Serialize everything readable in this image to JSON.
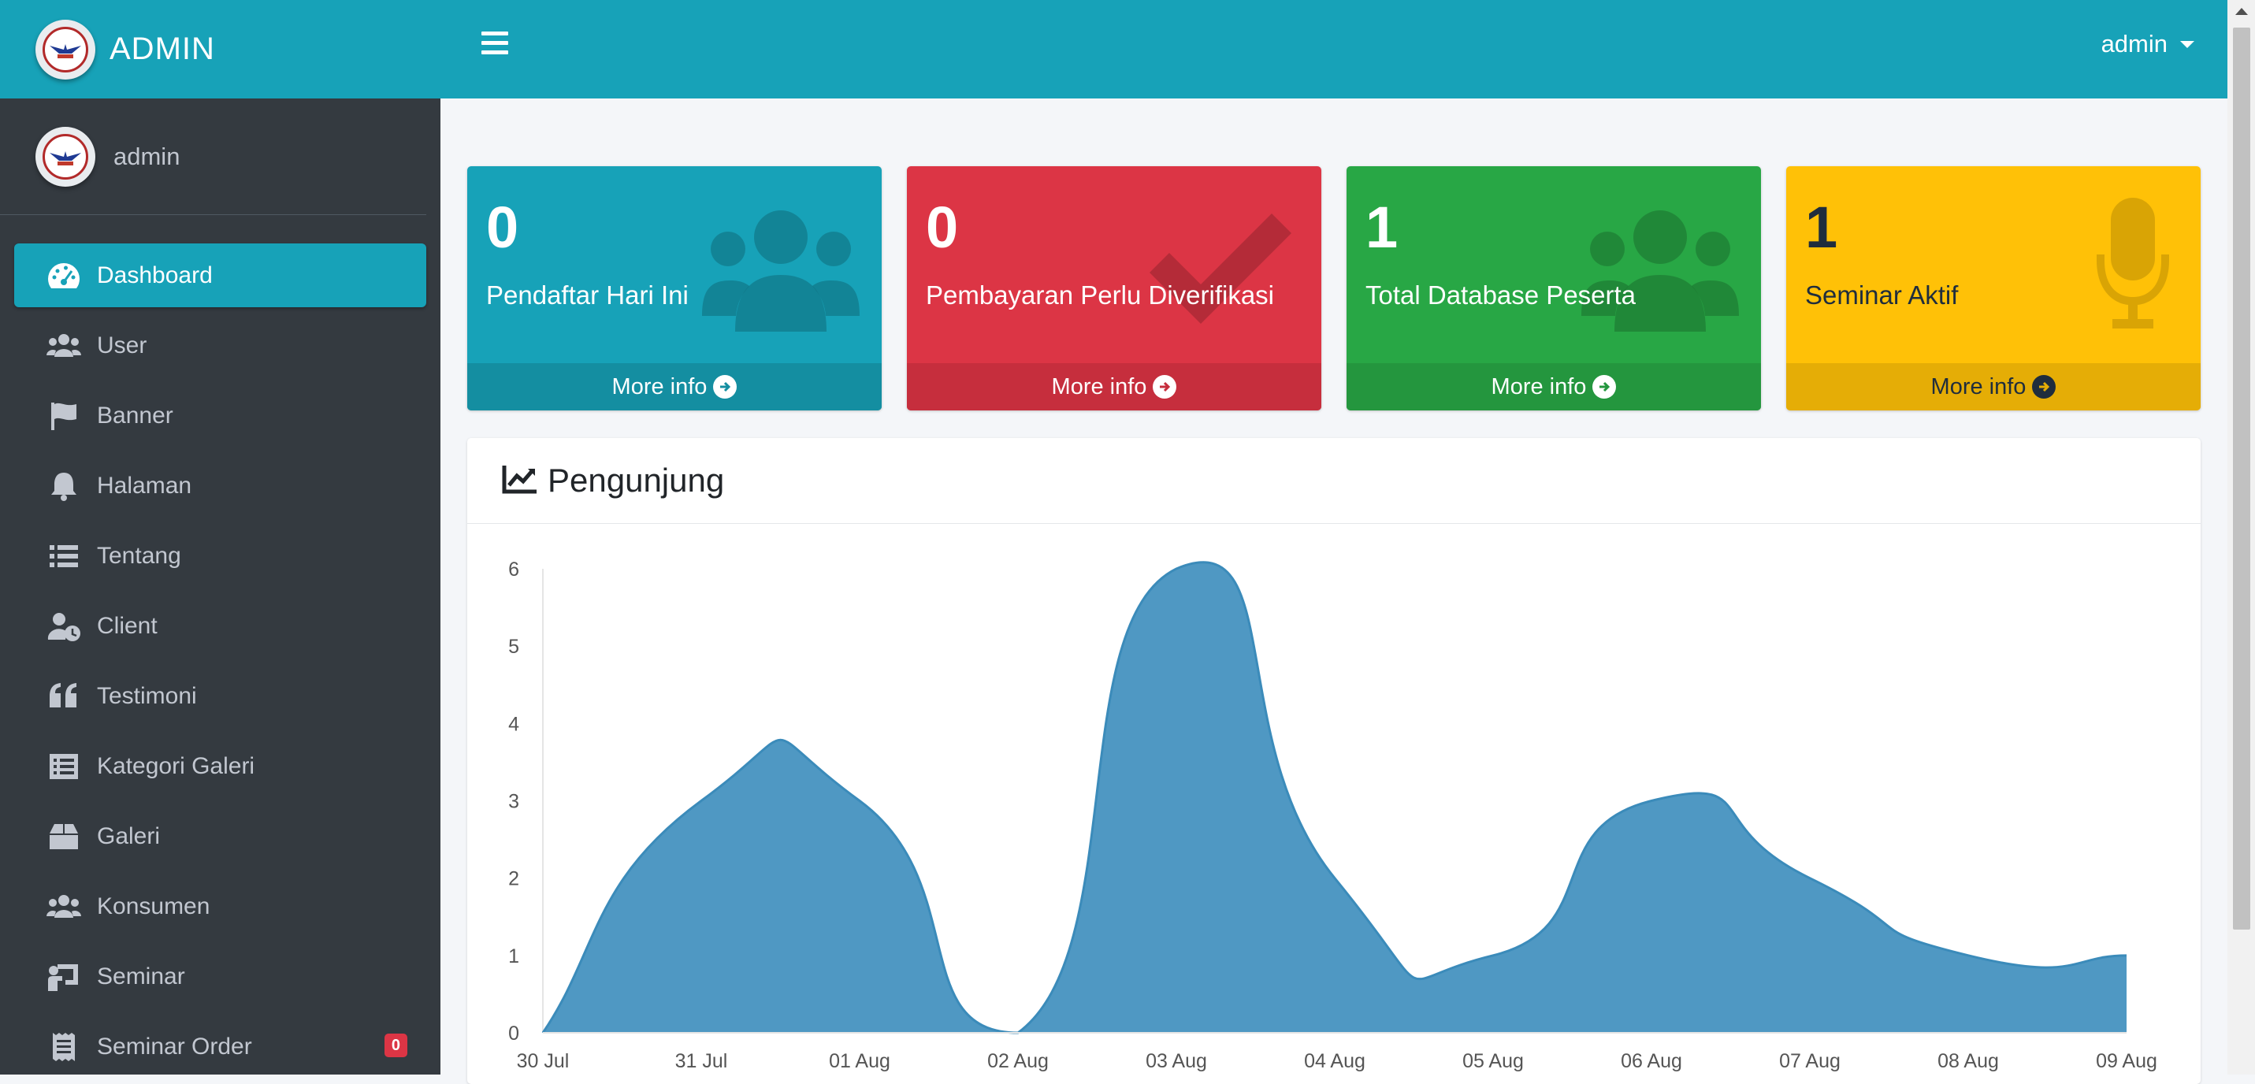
{
  "brand": {
    "title": "ADMIN"
  },
  "user_panel": {
    "name": "admin"
  },
  "sidebar": {
    "items": [
      {
        "label": "Dashboard",
        "icon": "tachometer-icon",
        "active": true
      },
      {
        "label": "User",
        "icon": "users-icon"
      },
      {
        "label": "Banner",
        "icon": "flag-icon"
      },
      {
        "label": "Halaman",
        "icon": "bell-icon"
      },
      {
        "label": "Tentang",
        "icon": "list-icon"
      },
      {
        "label": "Client",
        "icon": "user-clock-icon"
      },
      {
        "label": "Testimoni",
        "icon": "quote-icon"
      },
      {
        "label": "Kategori Galeri",
        "icon": "list-alt-icon"
      },
      {
        "label": "Galeri",
        "icon": "box-icon"
      },
      {
        "label": "Konsumen",
        "icon": "users-icon"
      },
      {
        "label": "Seminar",
        "icon": "chalkboard-teacher-icon"
      },
      {
        "label": "Seminar Order",
        "icon": "receipt-icon",
        "badge": "0"
      }
    ]
  },
  "topbar": {
    "user": "admin"
  },
  "info_boxes": [
    {
      "value": "0",
      "label": "Pendaftar Hari Ini",
      "footer": "More info",
      "color": "#17a2b8",
      "icon": "users-icon"
    },
    {
      "value": "0",
      "label": "Pembayaran Perlu Diverifikasi",
      "footer": "More info",
      "color": "#dc3545",
      "icon": "check-icon"
    },
    {
      "value": "1",
      "label": "Total Database Peserta",
      "footer": "More info",
      "color": "#28a745",
      "icon": "users-icon"
    },
    {
      "value": "1",
      "label": "Seminar Aktif",
      "footer": "More info",
      "color": "#ffc107",
      "icon": "microphone-icon"
    }
  ],
  "chart_card": {
    "title": "Pengunjung",
    "icon": "chart-line-icon"
  },
  "chart_data": {
    "type": "area",
    "title": "Pengunjung",
    "categories": [
      "30 Jul",
      "31 Jul",
      "01 Aug",
      "02 Aug",
      "03 Aug",
      "04 Aug",
      "05 Aug",
      "06 Aug",
      "07 Aug",
      "08 Aug",
      "09 Aug"
    ],
    "series": [
      {
        "values": [
          0,
          3,
          3,
          0,
          6,
          2,
          1,
          3,
          2,
          1,
          1
        ]
      }
    ],
    "ylim": [
      0,
      6
    ],
    "yticks": [
      0,
      1,
      2,
      3,
      4,
      5,
      6
    ],
    "color": "#3c8dbc",
    "grid": false,
    "legend": "none"
  }
}
